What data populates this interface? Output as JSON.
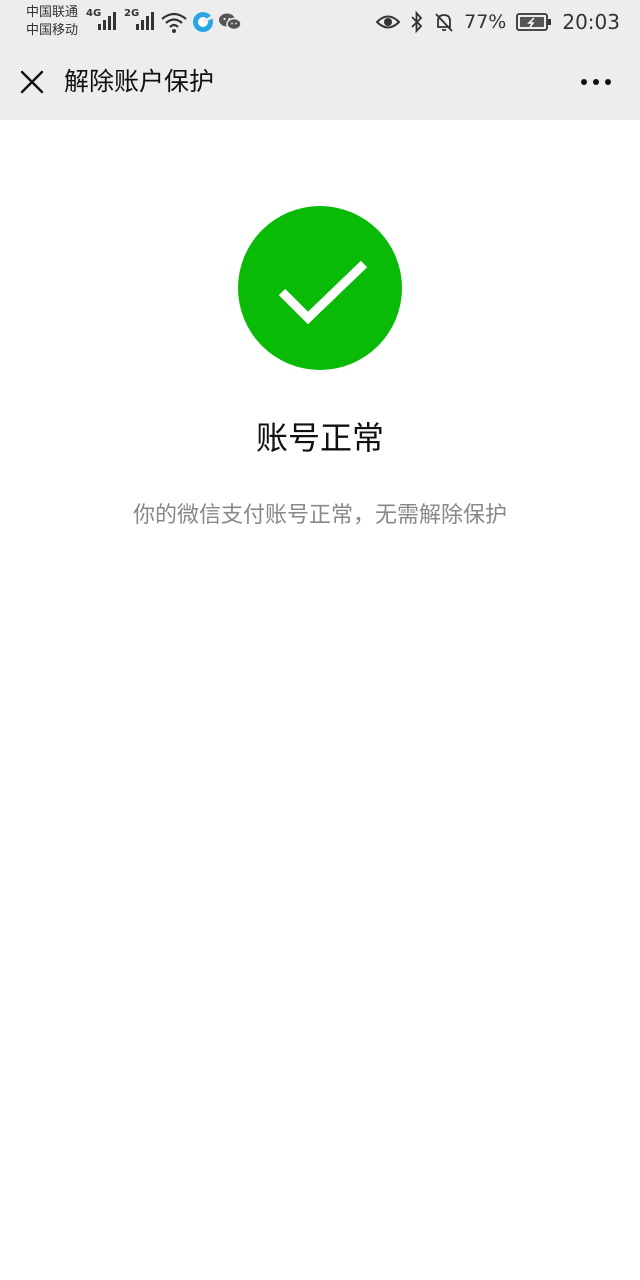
{
  "status_bar": {
    "carrier_1": "中国联通",
    "carrier_2": "中国移动",
    "sim1_tech": "4G",
    "sim2_tech": "2G",
    "battery_percent": "77%",
    "time": "20:03"
  },
  "nav": {
    "title": "解除账户保护",
    "close_icon": "close-icon",
    "more_icon": "more-icon"
  },
  "content": {
    "status_icon": "checkmark-icon",
    "title": "账号正常",
    "description": "你的微信支付账号正常，无需解除保护"
  },
  "colors": {
    "success_green": "#09bb07",
    "nav_background": "#ededed",
    "description_gray": "#888888"
  }
}
